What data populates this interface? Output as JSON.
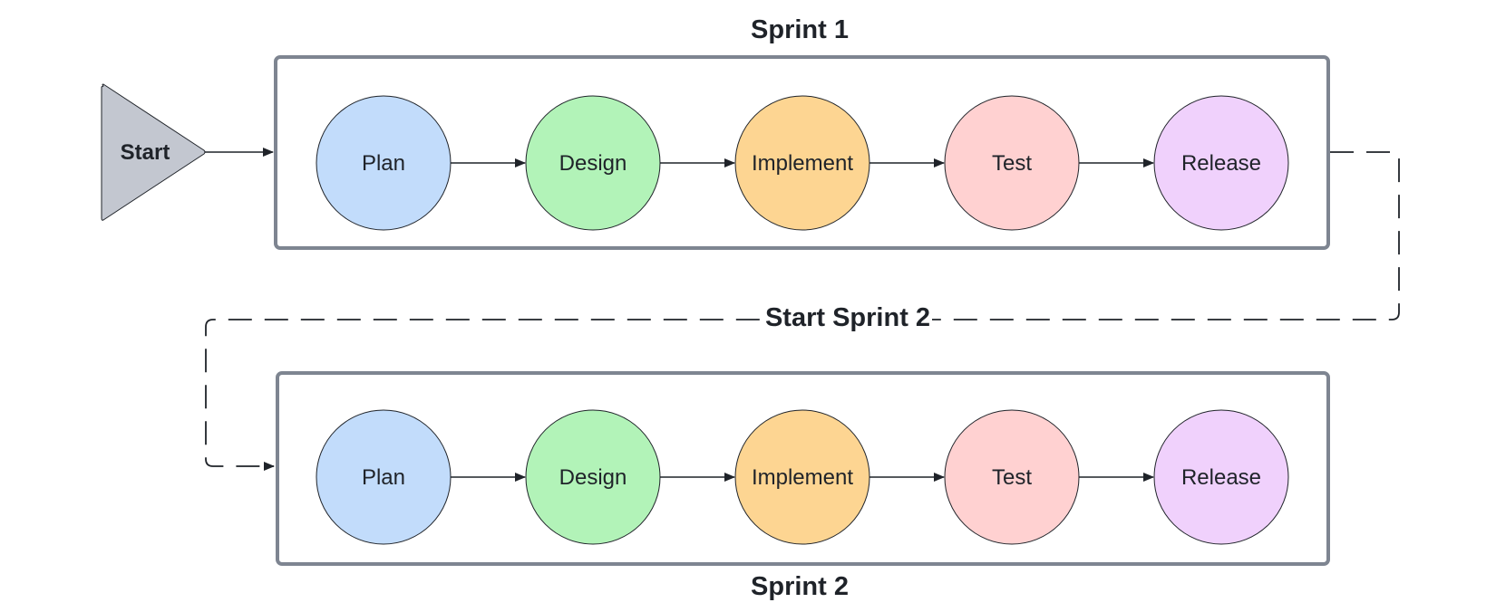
{
  "diagram": {
    "start": {
      "label": "Start",
      "fill": "#c3c7d0"
    },
    "transition_label": "Start Sprint 2",
    "sprints": [
      {
        "title": "Sprint 1",
        "stages": [
          {
            "label": "Plan",
            "color": "#c2dcfb"
          },
          {
            "label": "Design",
            "color": "#b2f3b8"
          },
          {
            "label": "Implement",
            "color": "#fdd592"
          },
          {
            "label": "Test",
            "color": "#ffd1d1"
          },
          {
            "label": "Release",
            "color": "#f0d1fc"
          }
        ]
      },
      {
        "title": "Sprint 2",
        "stages": [
          {
            "label": "Plan",
            "color": "#c2dcfb"
          },
          {
            "label": "Design",
            "color": "#b2f3b8"
          },
          {
            "label": "Implement",
            "color": "#fdd592"
          },
          {
            "label": "Test",
            "color": "#ffd1d1"
          },
          {
            "label": "Release",
            "color": "#f0d1fc"
          }
        ]
      }
    ],
    "colors": {
      "container_border": "#7e8591",
      "line": "#1f2329"
    }
  }
}
